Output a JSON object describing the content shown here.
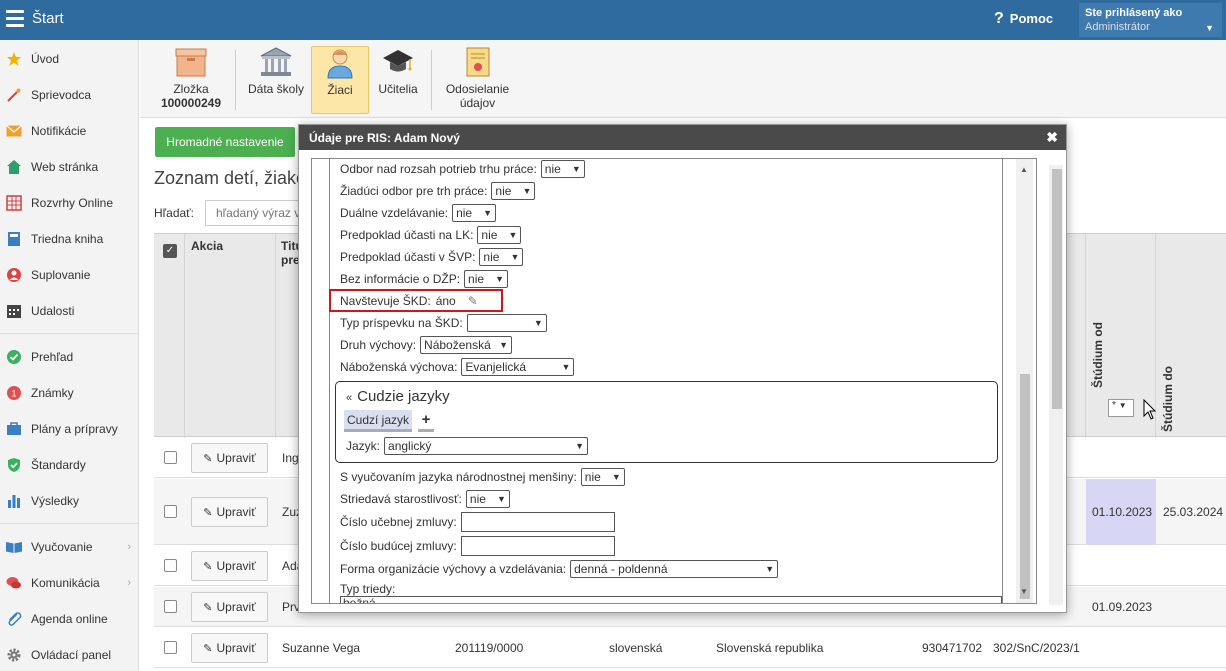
{
  "app": {
    "title": "Štart",
    "help_label": "Pomoc",
    "help_icon": "question-icon",
    "user_prefix": "Ste prihlásený ako",
    "user_name": "Administrátor"
  },
  "sidebar": {
    "items": [
      {
        "label": "Úvod",
        "icon": "star-icon",
        "color": "#f0b400"
      },
      {
        "label": "Sprievodca",
        "icon": "wand-icon",
        "color": "#e04040"
      },
      {
        "label": "Notifikácie",
        "icon": "envelope-icon",
        "color": "#f0a030"
      },
      {
        "label": "Web stránka",
        "icon": "home-icon",
        "color": "#2e9e6a"
      },
      {
        "label": "Rozvrhy Online",
        "icon": "calendar-grid-icon",
        "color": "#d04040"
      },
      {
        "label": "Triedna kniha",
        "icon": "book-icon",
        "color": "#3a7fc1"
      },
      {
        "label": "Suplovanie",
        "icon": "person-circle-icon",
        "color": "#e04040"
      },
      {
        "label": "Udalosti",
        "icon": "calendar-icon",
        "color": "#444444"
      },
      {
        "label": "Prehľad",
        "icon": "check-circle-icon",
        "color": "#3ab060"
      },
      {
        "label": "Známky",
        "icon": "grade-circle-icon",
        "color": "#e05050"
      },
      {
        "label": "Plány a prípravy",
        "icon": "briefcase-icon",
        "color": "#3a7fc1"
      },
      {
        "label": "Štandardy",
        "icon": "shield-check-icon",
        "color": "#3ab060"
      },
      {
        "label": "Výsledky",
        "icon": "bar-chart-icon",
        "color": "#3a7fc1"
      },
      {
        "label": "Vyučovanie",
        "icon": "open-book-icon",
        "color": "#3a7fc1"
      },
      {
        "label": "Komunikácia",
        "icon": "chat-icon",
        "color": "#e05050"
      },
      {
        "label": "Agenda online",
        "icon": "paperclip-icon",
        "color": "#3a7fc1"
      },
      {
        "label": "Ovládací panel",
        "icon": "gear-icon",
        "color": "#777777"
      }
    ]
  },
  "toolbar": {
    "items": [
      {
        "label": "Zložka",
        "sublabel": "100000249",
        "icon": "folder-box-icon"
      },
      {
        "label": "Dáta školy",
        "icon": "school-building-icon"
      },
      {
        "label": "Žiaci",
        "icon": "student-icon"
      },
      {
        "label": "Učitelia",
        "icon": "graduation-cap-icon"
      },
      {
        "label": "Odosielanie údajov",
        "icon": "certificate-icon"
      }
    ]
  },
  "main": {
    "bulk_button": "Hromadné nastavenie",
    "heading": "Zoznam detí, žiako",
    "search_label": "Hľadať:",
    "search_placeholder": "hľadaný výraz v",
    "columns": {
      "akcia": "Akcia",
      "titul": "Titu\npre",
      "studium_od": "Štúdium od",
      "studium_do": "Štúdium do",
      "filter_value": "*"
    },
    "edit_label": "Upraviť",
    "rows": [
      {
        "name": "Ing",
        "studium_od": "",
        "studium_do": ""
      },
      {
        "name": "Zuz",
        "studium_od": "01.10.2023",
        "studium_do": "25.03.2024"
      },
      {
        "name": "Ada",
        "studium_od": "",
        "studium_do": ""
      },
      {
        "name": "Prv",
        "studium_od": "01.09.2023",
        "studium_do": ""
      },
      {
        "name": "Suzanne Vega",
        "id": "201119/0000",
        "jazyk": "slovenská",
        "stat": "Slovenská republika",
        "cislo": "930471702",
        "zmluva": "302/SnC/2023/1",
        "studium_od": "",
        "studium_do": ""
      }
    ]
  },
  "modal": {
    "title": "Údaje pre RIS: Adam Nový",
    "fields": [
      {
        "label": "Odbor nad rozsah potrieb trhu práce:",
        "value": "nie"
      },
      {
        "label": "Žiadúci odbor pre trh práce:",
        "value": "nie"
      },
      {
        "label": "Duálne vzdelávanie:",
        "value": "nie"
      },
      {
        "label": "Predpoklad účasti na LK:",
        "value": "nie"
      },
      {
        "label": "Predpoklad účasti v ŠVP:",
        "value": "nie"
      },
      {
        "label": "Bez informácie o DŽP:",
        "value": "nie"
      },
      {
        "label": "Navštevuje ŠKD:",
        "value": "áno"
      },
      {
        "label": "Typ príspevku na ŠKD:",
        "value": ""
      },
      {
        "label": "Druh výchovy:",
        "value": "Náboženská"
      },
      {
        "label": "Náboženská výchova:",
        "value": "Evanjelická"
      }
    ],
    "cudzie_jazyky": {
      "title": "Cudzie jazyky",
      "tab": "Cudzí jazyk",
      "add": "+",
      "jazyk_label": "Jazyk:",
      "jazyk_value": "anglický"
    },
    "fields2": [
      {
        "label": "S vyučovaním jazyka národnostnej menšiny:",
        "value": "nie"
      },
      {
        "label": "Striedavá starostlivosť:",
        "value": "nie"
      },
      {
        "label": "Číslo učebnej zmluvy:",
        "value": ""
      },
      {
        "label": "Číslo budúcej zmluvy:",
        "value": ""
      },
      {
        "label": "Forma organizácie výchovy a vzdelávania:",
        "value": "denná - poldenná"
      },
      {
        "label": "Typ triedy:",
        "value": "bežná"
      }
    ]
  }
}
